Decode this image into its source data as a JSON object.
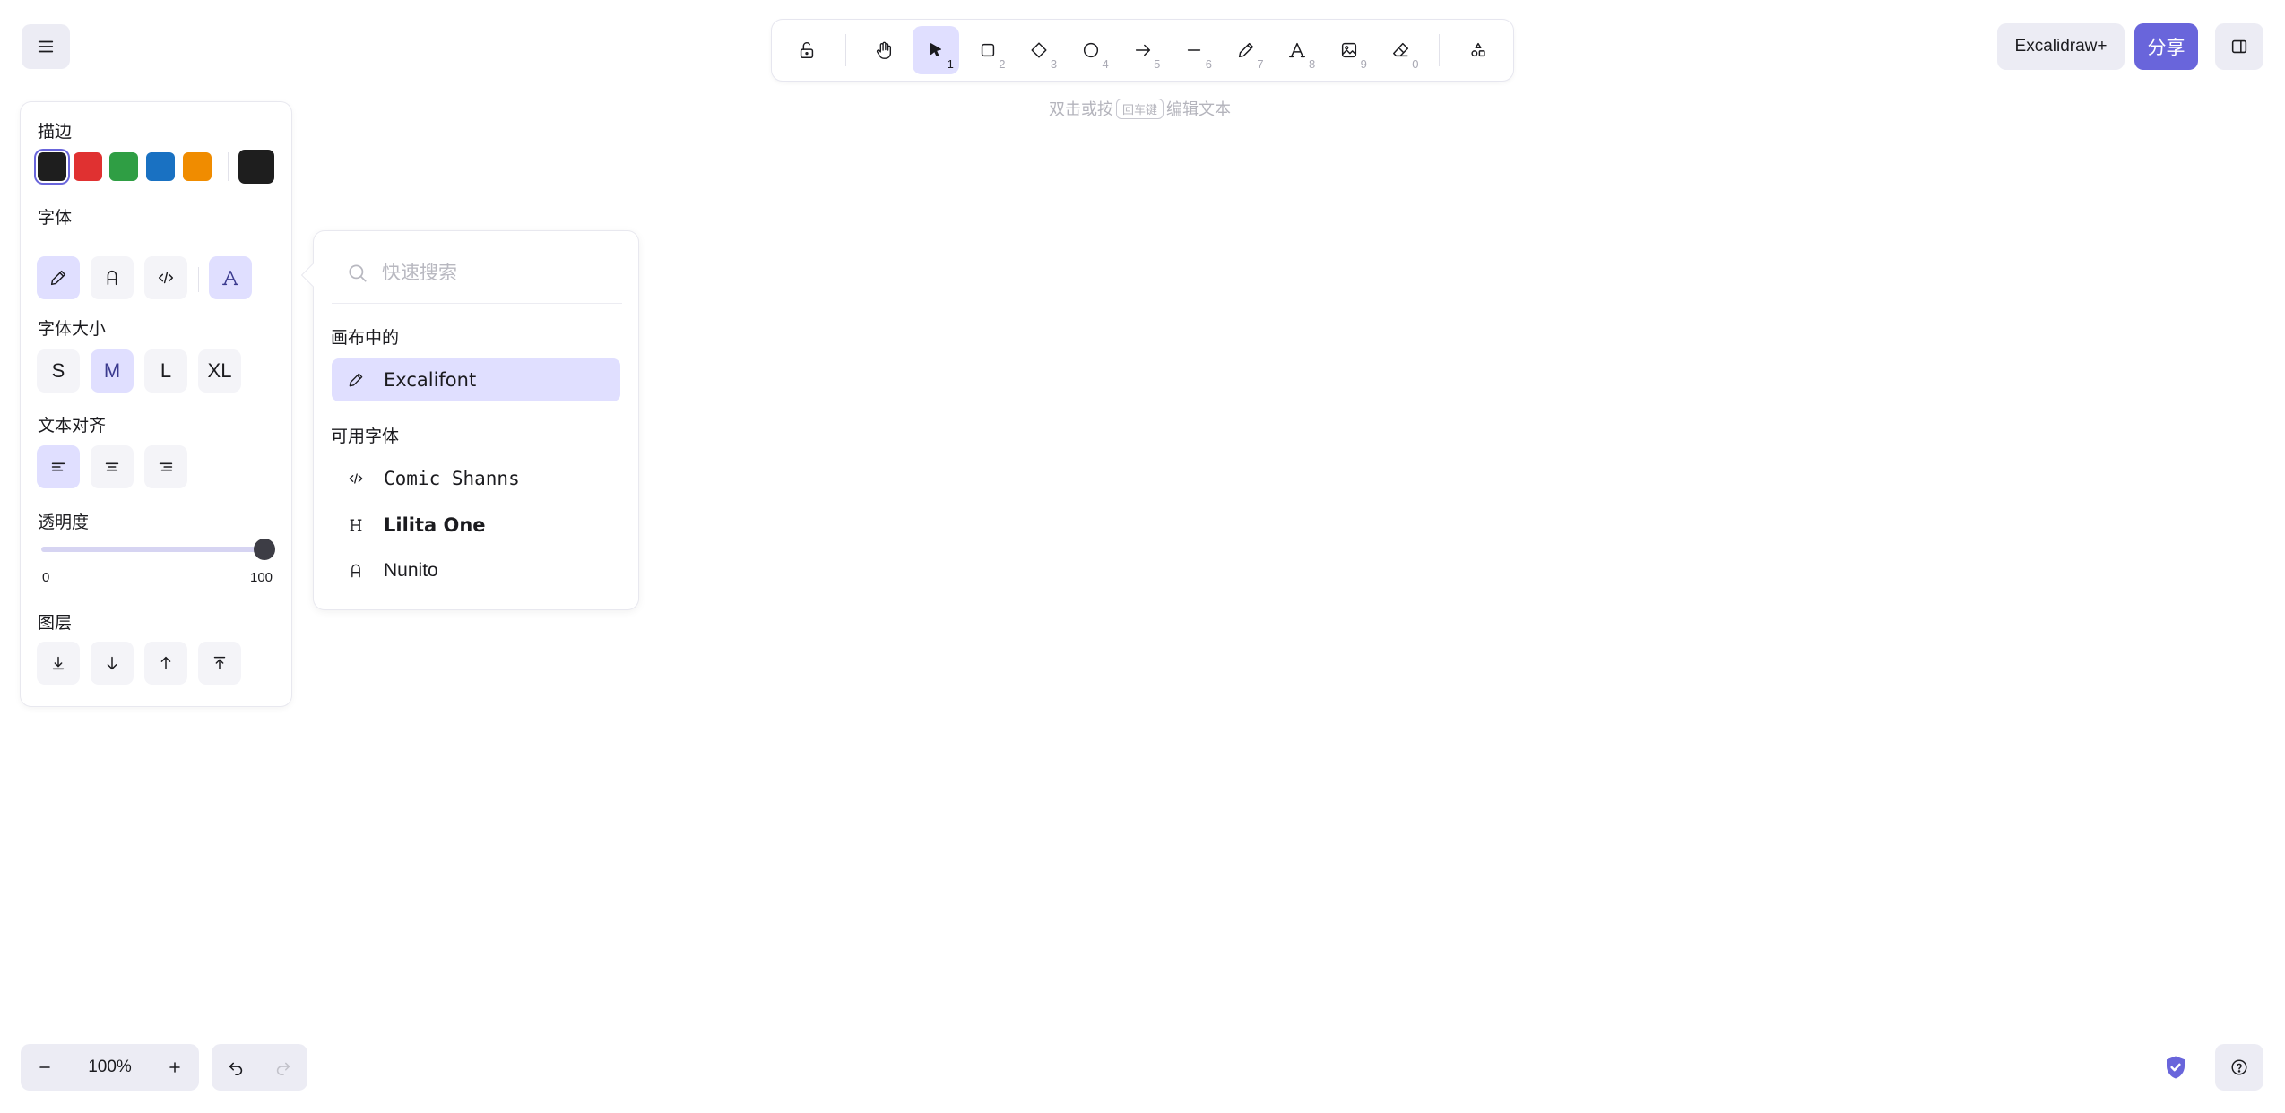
{
  "colors": {
    "accent": "#6965db",
    "active_bg": "#e0dfff",
    "stroke_swatches": [
      "#1e1e1e",
      "#e03131",
      "#2f9e44",
      "#1971c2",
      "#f08c00"
    ],
    "current_stroke": "#1e1e1e"
  },
  "menu": {
    "icon": "hamburger-icon"
  },
  "toolbar": {
    "tools": [
      {
        "name": "lock",
        "icon": "lock-open-icon",
        "key": ""
      },
      {
        "name": "hand",
        "icon": "hand-icon",
        "key": ""
      },
      {
        "name": "selection",
        "icon": "pointer-icon",
        "key": "1",
        "active": true
      },
      {
        "name": "rectangle",
        "icon": "rectangle-icon",
        "key": "2"
      },
      {
        "name": "diamond",
        "icon": "diamond-icon",
        "key": "3"
      },
      {
        "name": "ellipse",
        "icon": "ellipse-icon",
        "key": "4"
      },
      {
        "name": "arrow",
        "icon": "arrow-icon",
        "key": "5"
      },
      {
        "name": "line",
        "icon": "line-icon",
        "key": "6"
      },
      {
        "name": "draw",
        "icon": "pencil-icon",
        "key": "7"
      },
      {
        "name": "text",
        "icon": "text-icon",
        "key": "8"
      },
      {
        "name": "image",
        "icon": "image-icon",
        "key": "9"
      },
      {
        "name": "eraser",
        "icon": "eraser-icon",
        "key": "0"
      },
      {
        "name": "extra-tools",
        "icon": "shapes-icon",
        "key": ""
      }
    ]
  },
  "hint": {
    "before": "双击或按",
    "key": "回车键",
    "after": "编辑文本"
  },
  "header_right": {
    "plus_label": "Excalidraw+",
    "share_label": "分享"
  },
  "props": {
    "stroke_label": "描边",
    "font_family_label": "字体",
    "font_size_label": "字体大小",
    "font_sizes": [
      "S",
      "M",
      "L",
      "XL"
    ],
    "font_size_selected": "M",
    "text_align_label": "文本对齐",
    "opacity_label": "透明度",
    "opacity_min": "0",
    "opacity_max": "100",
    "opacity_value": 100,
    "layers_label": "图层"
  },
  "font_picker": {
    "search_placeholder": "快速搜索",
    "in_canvas_label": "画布中的",
    "in_canvas": [
      {
        "name": "Excalifont",
        "icon": "pencil-icon"
      }
    ],
    "available_label": "可用字体",
    "available": [
      {
        "name": "Comic Shanns",
        "icon": "code-icon"
      },
      {
        "name": "Lilita One",
        "icon": "heading-icon"
      },
      {
        "name": "Nunito",
        "icon": "letter-a-icon"
      }
    ]
  },
  "footer": {
    "zoom": "100%"
  }
}
